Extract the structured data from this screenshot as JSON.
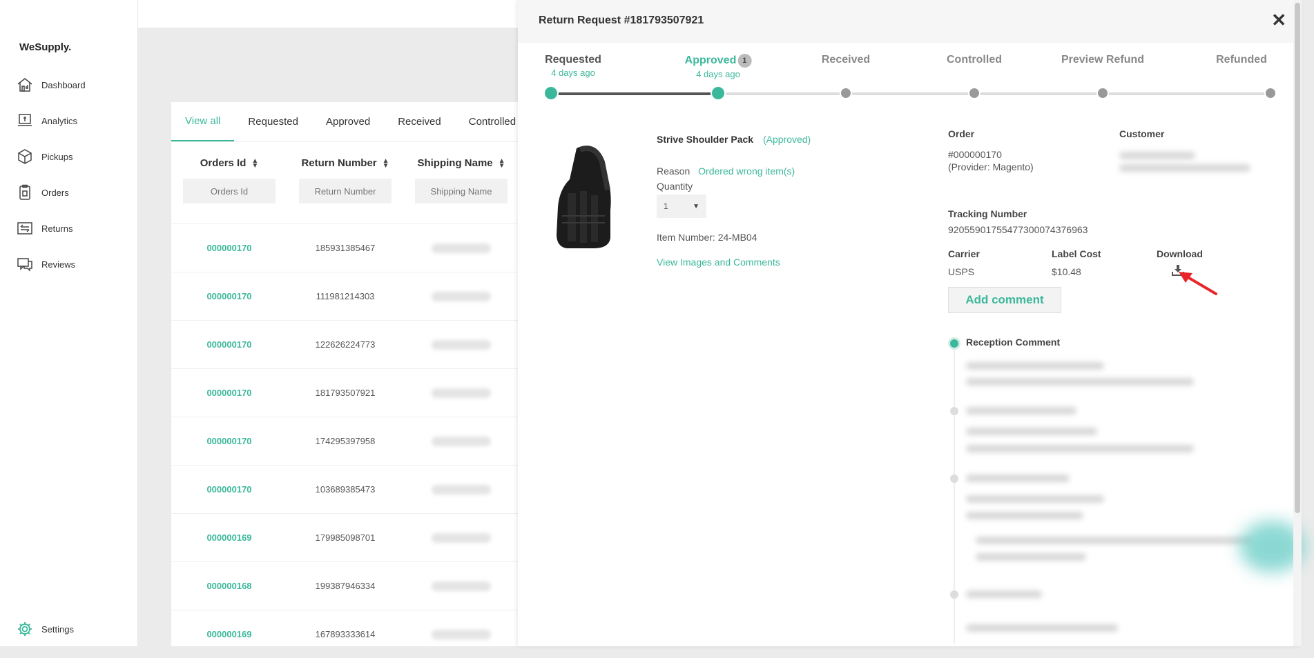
{
  "app": {
    "logo": "WeSupply."
  },
  "sidebar": {
    "items": [
      {
        "label": "Dashboard",
        "icon": "dashboard-icon"
      },
      {
        "label": "Analytics",
        "icon": "analytics-icon"
      },
      {
        "label": "Pickups",
        "icon": "pickups-icon"
      },
      {
        "label": "Orders",
        "icon": "orders-icon"
      },
      {
        "label": "Returns",
        "icon": "returns-icon"
      },
      {
        "label": "Reviews",
        "icon": "reviews-icon"
      }
    ],
    "settings": {
      "label": "Settings",
      "icon": "gear-icon"
    }
  },
  "tabs": [
    "View all",
    "Requested",
    "Approved",
    "Received",
    "Controlled"
  ],
  "table": {
    "columns": [
      {
        "title": "Orders Id",
        "placeholder": "Orders Id"
      },
      {
        "title": "Return Number",
        "placeholder": "Return Number"
      },
      {
        "title": "Shipping Name",
        "placeholder": "Shipping Name"
      }
    ],
    "rows": [
      {
        "order": "000000170",
        "ret": "185931385467"
      },
      {
        "order": "000000170",
        "ret": "111981214303"
      },
      {
        "order": "000000170",
        "ret": "122626224773"
      },
      {
        "order": "000000170",
        "ret": "181793507921"
      },
      {
        "order": "000000170",
        "ret": "174295397958"
      },
      {
        "order": "000000170",
        "ret": "103689385473"
      },
      {
        "order": "000000169",
        "ret": "179985098701"
      },
      {
        "order": "000000168",
        "ret": "199387946334"
      },
      {
        "order": "000000169",
        "ret": "167893333614"
      }
    ]
  },
  "panel": {
    "title": "Return Request #181793507921",
    "close": "✕",
    "steps": [
      {
        "label": "Requested",
        "sub": "4 days ago"
      },
      {
        "label": "Approved",
        "sub": "4 days ago",
        "badge": "1"
      },
      {
        "label": "Received",
        "sub": ""
      },
      {
        "label": "Controlled",
        "sub": ""
      },
      {
        "label": "Preview Refund",
        "sub": ""
      },
      {
        "label": "Refunded",
        "sub": ""
      }
    ],
    "product": {
      "name": "Strive Shoulder Pack",
      "status": "(Approved)",
      "reason_label": "Reason",
      "reason_value": "Ordered wrong item(s)",
      "quantity_label": "Quantity",
      "quantity_value": "1",
      "item_number": "Item Number: 24-MB04",
      "view_link": "View Images and Comments"
    },
    "details": {
      "order_label": "Order",
      "order_value": "#000000170",
      "order_provider": "(Provider: Magento)",
      "customer_label": "Customer",
      "tracking_label": "Tracking Number",
      "tracking_value": "9205590175547730007437696​3",
      "carrier_label": "Carrier",
      "carrier_value": "USPS",
      "label_cost_label": "Label Cost",
      "label_cost_value": "$10.48",
      "download_label": "Download",
      "add_comment": "Add comment",
      "reception_comment": "Reception Comment"
    }
  },
  "colors": {
    "accent": "#3bb89b",
    "arrow": "#e8262a"
  }
}
